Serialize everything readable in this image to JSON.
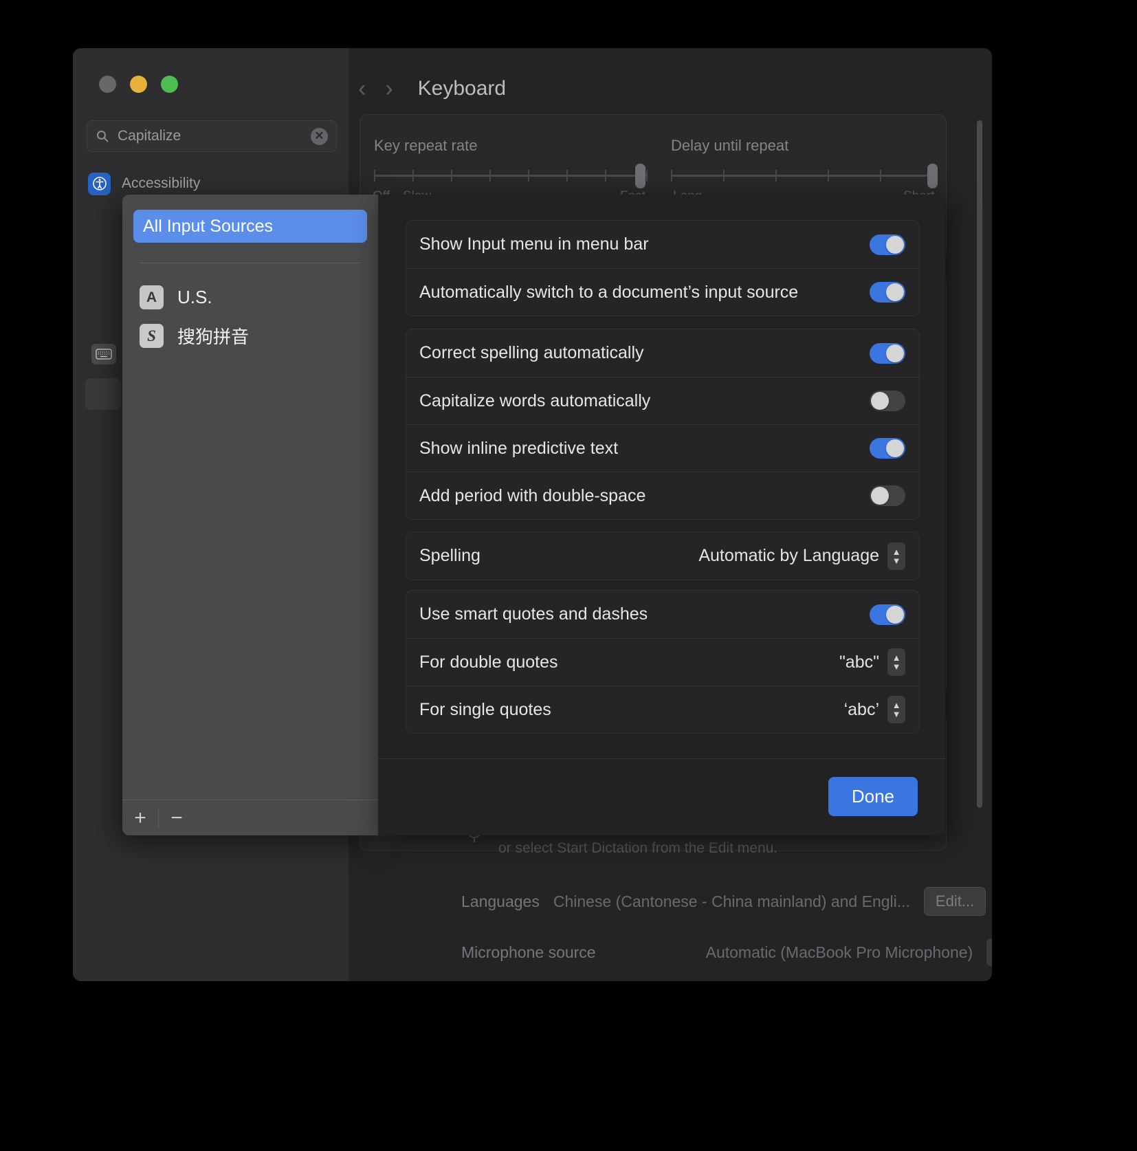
{
  "window": {
    "traffic_lights": [
      "close",
      "minimize",
      "zoom"
    ],
    "search": {
      "value": "Capitalize",
      "icon": "search-icon",
      "clear_icon": "clear-icon"
    },
    "sidebar_item": {
      "label": "Accessibility",
      "icon": "accessibility-icon"
    },
    "nav": {
      "back_icon": "chevron-left-icon",
      "forward_icon": "chevron-right-icon",
      "title": "Keyboard"
    },
    "key_repeat": {
      "label": "Key repeat rate",
      "min_label": "Off",
      "second_label": "Slow",
      "max_label": "Fast"
    },
    "delay_repeat": {
      "label": "Delay until repeat",
      "min_label": "Long",
      "max_label": "Short"
    },
    "dictation_hint": "or select Start Dictation from the Edit menu.",
    "languages": {
      "label": "Languages",
      "value": "Chinese (Cantonese - China mainland) and Engli...",
      "edit_button": "Edit..."
    },
    "microphone": {
      "label": "Microphone source",
      "value": "Automatic (MacBook Pro Microphone)"
    }
  },
  "sheet": {
    "sources_header": "All Input Sources",
    "sources": [
      {
        "label": "U.S.",
        "icon_glyph": "A",
        "icon_name": "us-keyboard-icon"
      },
      {
        "label": "搜狗拼音",
        "icon_glyph": "S",
        "icon_name": "sogou-pinyin-icon"
      }
    ],
    "footer": {
      "add": "+",
      "remove": "−"
    },
    "groups": [
      {
        "name": "input-menu-group",
        "rows": [
          {
            "name": "show-input-menu",
            "label": "Show Input menu in menu bar",
            "control": "toggle",
            "value": "on"
          },
          {
            "name": "auto-switch-source",
            "label": "Automatically switch to a document’s input source",
            "control": "toggle",
            "value": "on"
          }
        ]
      },
      {
        "name": "text-input-group",
        "rows": [
          {
            "name": "correct-spelling",
            "label": "Correct spelling automatically",
            "control": "toggle",
            "value": "on"
          },
          {
            "name": "capitalize-words",
            "label": "Capitalize words automatically",
            "control": "toggle",
            "value": "off"
          },
          {
            "name": "inline-predictive-text",
            "label": "Show inline predictive text",
            "control": "toggle",
            "value": "on"
          },
          {
            "name": "add-period-double-space",
            "label": "Add period with double-space",
            "control": "toggle",
            "value": "off"
          }
        ]
      },
      {
        "name": "spelling-group",
        "rows": [
          {
            "name": "spelling",
            "label": "Spelling",
            "control": "popup",
            "value": "Automatic by Language"
          }
        ]
      },
      {
        "name": "smart-quotes-group",
        "rows": [
          {
            "name": "use-smart-quotes",
            "label": "Use smart quotes and dashes",
            "control": "toggle",
            "value": "on"
          },
          {
            "name": "double-quotes",
            "label": "For double quotes",
            "control": "popup",
            "value": "\"abc\""
          },
          {
            "name": "single-quotes",
            "label": "For single quotes",
            "control": "popup",
            "value": "‘abc’"
          }
        ]
      }
    ],
    "done_button": "Done"
  },
  "colors": {
    "accent": "#3b76e0",
    "selection": "#5b8dea",
    "toggle_on": "#3b76e0",
    "toggle_off": "#434346",
    "sheet_bg": "#222224",
    "list_bg": "#4a4a4c"
  }
}
